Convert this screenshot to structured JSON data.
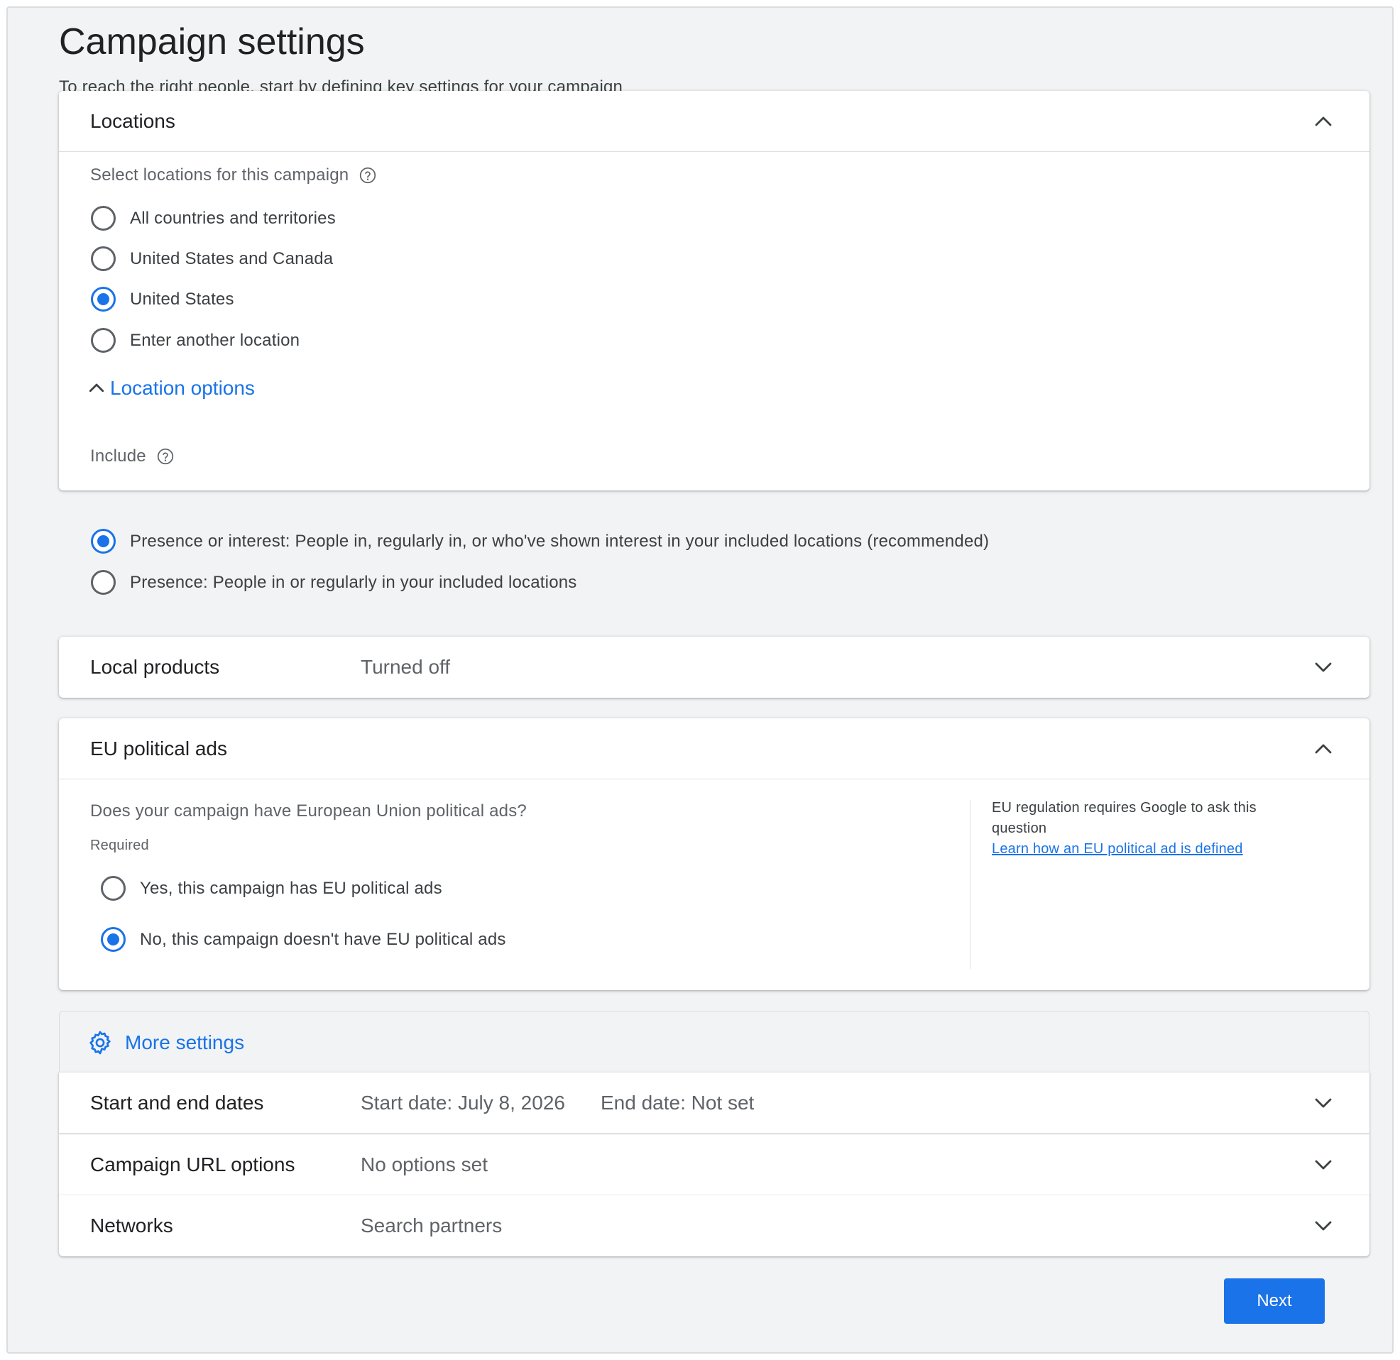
{
  "page": {
    "title": "Campaign settings",
    "subtitle": "To reach the right people, start by defining key settings for your campaign"
  },
  "locations": {
    "title": "Locations",
    "select_label": "Select locations for this campaign",
    "options": [
      {
        "label": "All countries and territories",
        "selected": false
      },
      {
        "label": "United States and Canada",
        "selected": false
      },
      {
        "label": "United States",
        "selected": true
      },
      {
        "label": "Enter another location",
        "selected": false
      }
    ],
    "location_options_label": "Location options",
    "include_label": "Include",
    "include_options": [
      {
        "label": "Presence or interest: People in, regularly in, or who've shown interest in your included locations (recommended)",
        "selected": true
      },
      {
        "label": "Presence: People in or regularly in your included locations",
        "selected": false
      }
    ]
  },
  "local_products": {
    "title": "Local products",
    "summary": "Turned off"
  },
  "eu_political_ads": {
    "title": "EU political ads",
    "question": "Does your campaign have European Union political ads?",
    "required": "Required",
    "options": [
      {
        "label": "Yes, this campaign has EU political ads",
        "selected": false
      },
      {
        "label": "No, this campaign doesn't have EU political ads",
        "selected": true
      }
    ],
    "note": "EU regulation requires Google to ask this question",
    "link": "Learn how an EU political ad is defined"
  },
  "more_settings": {
    "label": "More settings",
    "rows": [
      {
        "title": "Start and end dates",
        "summary": "Start date: July 8, 2026",
        "summary2": "End date: Not set"
      },
      {
        "title": "Campaign URL options",
        "summary": "No options set"
      },
      {
        "title": "Networks",
        "summary": "Search partners"
      }
    ]
  },
  "actions": {
    "next_label": "Next"
  },
  "colors": {
    "accent": "#1a73e8",
    "background": "#f1f3f4",
    "text": "#202124",
    "secondary_text": "#5f6368"
  }
}
